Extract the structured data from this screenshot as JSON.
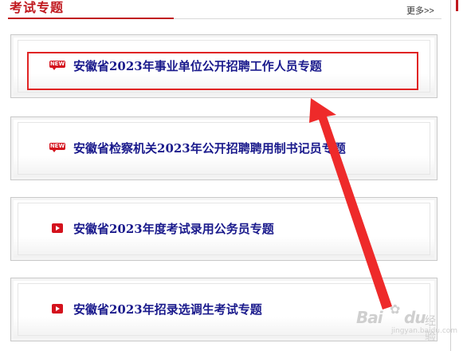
{
  "header": {
    "title": "考试专题",
    "more_label": "更多>>"
  },
  "colors": {
    "brand_red": "#c0181e",
    "link_blue": "#1a1a8c",
    "highlight_red": "#e02424"
  },
  "topics": [
    {
      "icon": "new-badge-icon",
      "icon_text": "NEW",
      "label": "安徽省2023年事业单位公开招聘工作人员专题"
    },
    {
      "icon": "new-badge-icon",
      "icon_text": "NEW",
      "label": "安徽省检察机关2023年公开招聘聘用制书记员专题"
    },
    {
      "icon": "play-icon",
      "label": "安徽省2023年度考试录用公务员专题"
    },
    {
      "icon": "play-icon",
      "label": "安徽省2023年招录选调生考试专题"
    }
  ],
  "watermark": {
    "brand": "Bai",
    "brand_suffix": "du",
    "chinese": "经验",
    "sub": "jingyan.baidu.com"
  }
}
